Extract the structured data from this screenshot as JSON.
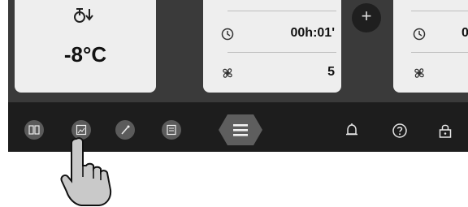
{
  "cards": {
    "left": {
      "temperature": "-8°C",
      "icon": "thermometer-defrost-icon"
    },
    "middle": {
      "timer_value": "00h:01'",
      "fan_value": "5",
      "timer_icon": "clock-icon",
      "fan_icon": "fan-icon"
    },
    "right": {
      "timer_value_partial": "0",
      "timer_icon": "clock-icon",
      "fan_icon": "fan-icon"
    }
  },
  "add_button": {
    "label": "+"
  },
  "nav": {
    "items": [
      {
        "icon": "split-view-icon"
      },
      {
        "icon": "image-gallery-icon"
      },
      {
        "icon": "probe-icon"
      },
      {
        "icon": "recipe-book-icon"
      }
    ],
    "menu": {
      "icon": "hamburger-menu-icon"
    },
    "right_items": [
      {
        "icon": "bell-icon"
      },
      {
        "icon": "help-icon"
      },
      {
        "icon": "lock-icon"
      }
    ]
  },
  "overlay": {
    "icon": "pointing-hand-icon"
  },
  "colors": {
    "screen_bg": "#3a3a3a",
    "bar_bg": "#1d1d1d",
    "card_bg": "#eeeeee",
    "nav_button_bg": "#5b5b5b"
  }
}
